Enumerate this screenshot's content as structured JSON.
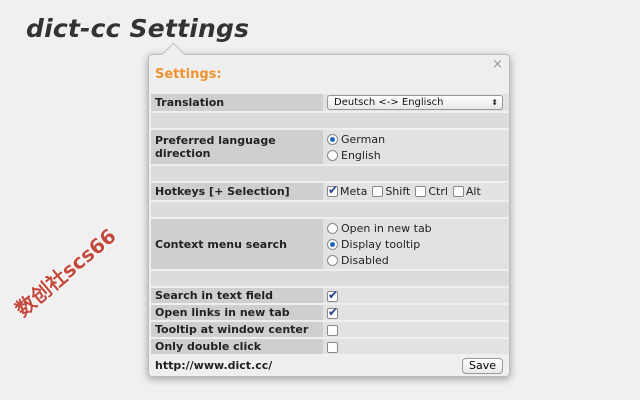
{
  "page_title": "dict-cc Settings",
  "watermark": "数创社scs66",
  "popup": {
    "heading": "Settings:",
    "close_symbol": "×",
    "translation": {
      "label": "Translation",
      "selected": "Deutsch <-> Englisch"
    },
    "language_direction": {
      "label": "Preferred language direction",
      "options": [
        "German",
        "English"
      ],
      "selected": "German"
    },
    "hotkeys": {
      "label": "Hotkeys [+ Selection]",
      "keys": [
        {
          "name": "Meta",
          "checked": true
        },
        {
          "name": "Shift",
          "checked": false
        },
        {
          "name": "Ctrl",
          "checked": false
        },
        {
          "name": "Alt",
          "checked": false
        }
      ]
    },
    "context_menu": {
      "label": "Context menu search",
      "options": [
        "Open in new tab",
        "Display tooltip",
        "Disabled"
      ],
      "selected": "Display tooltip"
    },
    "checkbox_settings": [
      {
        "label": "Search in text field",
        "checked": true
      },
      {
        "label": "Open links in new tab",
        "checked": true
      },
      {
        "label": "Tooltip at window center",
        "checked": false
      },
      {
        "label": "Only double click",
        "checked": false
      }
    ],
    "footer_link": "http://www.dict.cc/",
    "save_label": "Save"
  },
  "colors": {
    "heading": "#f0922e",
    "radio_selected": "#1e63c7"
  }
}
